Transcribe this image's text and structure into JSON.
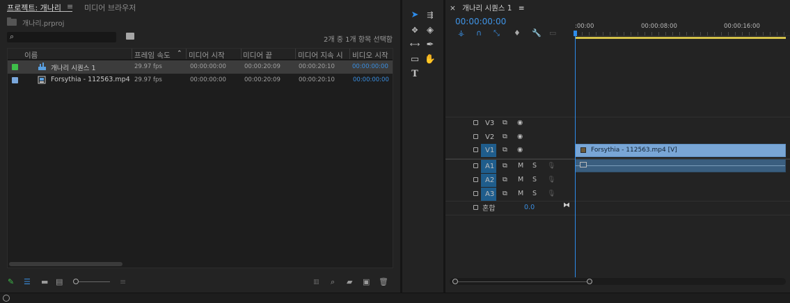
{
  "project": {
    "tabs": [
      {
        "label": "프로젝트: 개나리",
        "active": true
      },
      {
        "label": "미디어 브라우저",
        "active": false
      }
    ],
    "menu_icon": "≡",
    "project_file": "개나리.prproj",
    "search": {
      "value": "",
      "placeholder": ""
    },
    "selection_count": "2개 중 1개 항목 선택함",
    "columns": [
      "이름",
      "프레임 속도",
      "미디어 시작",
      "미디어 끝",
      "미디어 지속 시",
      "비디오 시작"
    ],
    "rows": [
      {
        "name": "개나리 시퀀스 1",
        "frame_rate": "29.97 fps",
        "media_start": "00:00:00:00",
        "media_end": "00:00:20:09",
        "media_duration": "00:00:20:10",
        "video_start": "00:00:00:00",
        "label_color": "#3fbf4a",
        "icon": "sequence-icon",
        "selected": true
      },
      {
        "name": "Forsythia - 112563.mp4",
        "frame_rate": "29.97 fps",
        "media_start": "00:00:00:00",
        "media_end": "00:00:20:09",
        "media_duration": "00:00:20:10",
        "video_start": "00:00:00:00",
        "label_color": "#7aa7dc",
        "icon": "video-file-icon",
        "selected": false
      }
    ]
  },
  "timeline": {
    "tab_label": "개나리 시퀀스 1",
    "close_glyph": "×",
    "menu_icon": "≡",
    "timecode": "00:00:00:00",
    "ruler_labels": [
      ":00:00",
      "00:00:08:00",
      "00:00:16:00"
    ],
    "tracks": [
      {
        "name": "V3",
        "type": "video",
        "targeted": false
      },
      {
        "name": "V2",
        "type": "video",
        "targeted": false
      },
      {
        "name": "V1",
        "type": "video",
        "targeted": true
      },
      {
        "name": "A1",
        "type": "audio",
        "targeted": true
      },
      {
        "name": "A2",
        "type": "audio",
        "targeted": true
      },
      {
        "name": "A3",
        "type": "audio",
        "targeted": true
      }
    ],
    "audio_buttons": {
      "mute": "M",
      "solo": "S"
    },
    "mix_label": "혼합",
    "mix_value": "0.0",
    "video_clip": "Forsythia - 112563.mp4 [V]"
  },
  "colors": {
    "accent": "#2d8ceb",
    "work_area": "#d4c24a",
    "video_clip": "#79a6d6",
    "audio_clip": "#3a5e7f",
    "track_target": "#1f5d8c"
  }
}
